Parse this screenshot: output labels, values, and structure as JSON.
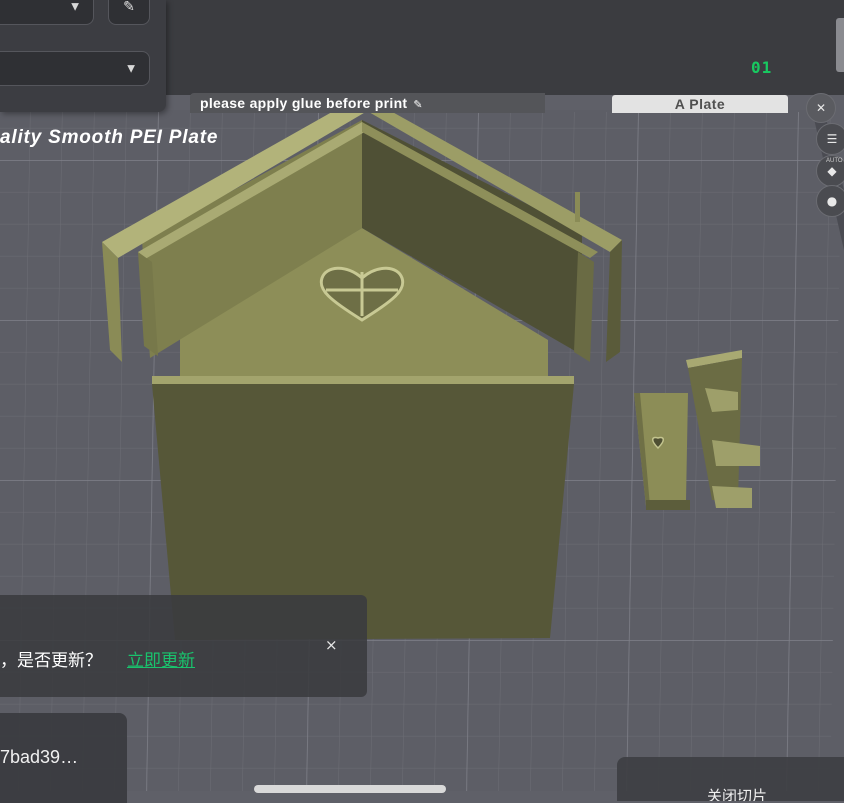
{
  "toolbar": {
    "edit_icon": "pencil-icon",
    "dropdown_icon": "chevron-down-icon"
  },
  "plate": {
    "number": "01",
    "note": "please apply glue before print",
    "tab_label": "A Plate",
    "name": "ality Smooth PEI Plate"
  },
  "right_tools": [
    "close-icon",
    "object-list-icon",
    "auto-orient-icon",
    "orient-icon"
  ],
  "right_tools_auto_label": "AUTO",
  "notification": {
    "message": "，是否更新？",
    "action": "立即更新",
    "close": "×"
  },
  "model_hash": "7bad39…",
  "bottom_panel_text": "关闭切片",
  "colors": {
    "model": "#8c8d55",
    "bed": "#5f6068",
    "grid": "#777880",
    "accent_green": "#19c36d",
    "panel": "#3c3d42"
  }
}
